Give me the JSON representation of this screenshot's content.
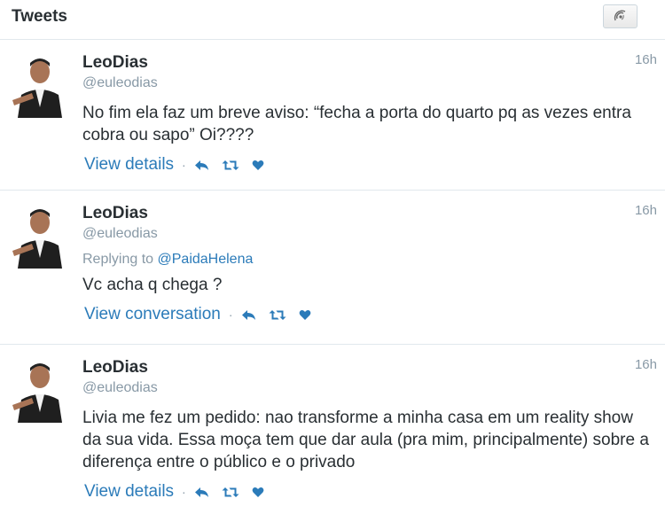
{
  "header": {
    "title": "Tweets"
  },
  "colors": {
    "link": "#2b7bb9",
    "muted": "#8899a6",
    "text": "#292f33"
  },
  "tweets": [
    {
      "name": "LeoDias",
      "handle": "@euleodias",
      "time": "16h",
      "text": "No fim ela faz um breve aviso: “fecha a porta do quarto pq as vezes entra cobra ou sapo” Oi????",
      "action_link": "View details"
    },
    {
      "name": "LeoDias",
      "handle": "@euleodias",
      "time": "16h",
      "reply_prefix": "Replying to",
      "reply_to": "@PaidaHelena",
      "text": "Vc acha q chega ?",
      "action_link": "View conversation"
    },
    {
      "name": "LeoDias",
      "handle": "@euleodias",
      "time": "16h",
      "text": "Livia me fez um pedido: nao transforme a minha casa em um reality show da sua vida. Essa moça tem que dar aula (pra mim, principalmente) sobre a diferença entre o público e o privado",
      "action_link": "View details"
    }
  ],
  "actions": {
    "separator": "·",
    "icons": [
      "reply-icon",
      "retweet-icon",
      "like-icon"
    ]
  }
}
